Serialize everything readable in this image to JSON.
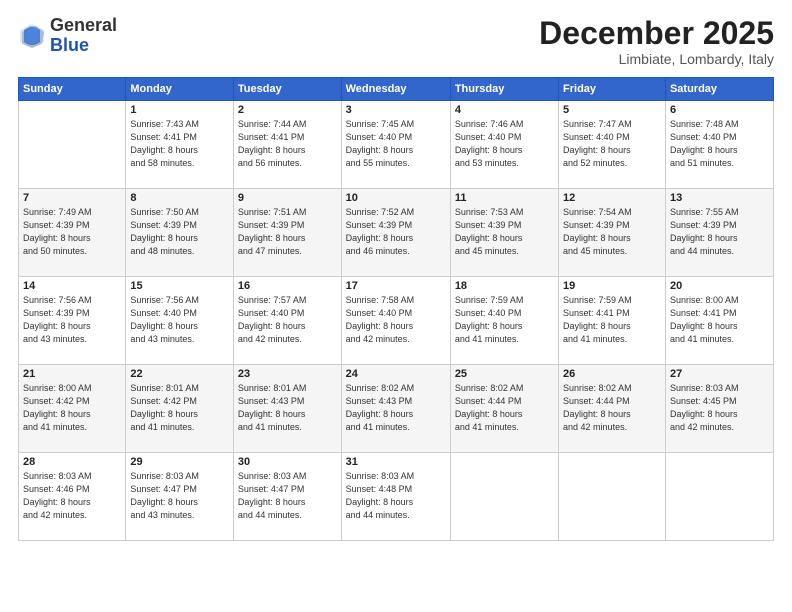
{
  "logo": {
    "general": "General",
    "blue": "Blue"
  },
  "header": {
    "month": "December 2025",
    "location": "Limbiate, Lombardy, Italy"
  },
  "days_of_week": [
    "Sunday",
    "Monday",
    "Tuesday",
    "Wednesday",
    "Thursday",
    "Friday",
    "Saturday"
  ],
  "weeks": [
    [
      {
        "day": "",
        "info": ""
      },
      {
        "day": "1",
        "info": "Sunrise: 7:43 AM\nSunset: 4:41 PM\nDaylight: 8 hours\nand 58 minutes."
      },
      {
        "day": "2",
        "info": "Sunrise: 7:44 AM\nSunset: 4:41 PM\nDaylight: 8 hours\nand 56 minutes."
      },
      {
        "day": "3",
        "info": "Sunrise: 7:45 AM\nSunset: 4:40 PM\nDaylight: 8 hours\nand 55 minutes."
      },
      {
        "day": "4",
        "info": "Sunrise: 7:46 AM\nSunset: 4:40 PM\nDaylight: 8 hours\nand 53 minutes."
      },
      {
        "day": "5",
        "info": "Sunrise: 7:47 AM\nSunset: 4:40 PM\nDaylight: 8 hours\nand 52 minutes."
      },
      {
        "day": "6",
        "info": "Sunrise: 7:48 AM\nSunset: 4:40 PM\nDaylight: 8 hours\nand 51 minutes."
      }
    ],
    [
      {
        "day": "7",
        "info": "Sunrise: 7:49 AM\nSunset: 4:39 PM\nDaylight: 8 hours\nand 50 minutes."
      },
      {
        "day": "8",
        "info": "Sunrise: 7:50 AM\nSunset: 4:39 PM\nDaylight: 8 hours\nand 48 minutes."
      },
      {
        "day": "9",
        "info": "Sunrise: 7:51 AM\nSunset: 4:39 PM\nDaylight: 8 hours\nand 47 minutes."
      },
      {
        "day": "10",
        "info": "Sunrise: 7:52 AM\nSunset: 4:39 PM\nDaylight: 8 hours\nand 46 minutes."
      },
      {
        "day": "11",
        "info": "Sunrise: 7:53 AM\nSunset: 4:39 PM\nDaylight: 8 hours\nand 45 minutes."
      },
      {
        "day": "12",
        "info": "Sunrise: 7:54 AM\nSunset: 4:39 PM\nDaylight: 8 hours\nand 45 minutes."
      },
      {
        "day": "13",
        "info": "Sunrise: 7:55 AM\nSunset: 4:39 PM\nDaylight: 8 hours\nand 44 minutes."
      }
    ],
    [
      {
        "day": "14",
        "info": "Sunrise: 7:56 AM\nSunset: 4:39 PM\nDaylight: 8 hours\nand 43 minutes."
      },
      {
        "day": "15",
        "info": "Sunrise: 7:56 AM\nSunset: 4:40 PM\nDaylight: 8 hours\nand 43 minutes."
      },
      {
        "day": "16",
        "info": "Sunrise: 7:57 AM\nSunset: 4:40 PM\nDaylight: 8 hours\nand 42 minutes."
      },
      {
        "day": "17",
        "info": "Sunrise: 7:58 AM\nSunset: 4:40 PM\nDaylight: 8 hours\nand 42 minutes."
      },
      {
        "day": "18",
        "info": "Sunrise: 7:59 AM\nSunset: 4:40 PM\nDaylight: 8 hours\nand 41 minutes."
      },
      {
        "day": "19",
        "info": "Sunrise: 7:59 AM\nSunset: 4:41 PM\nDaylight: 8 hours\nand 41 minutes."
      },
      {
        "day": "20",
        "info": "Sunrise: 8:00 AM\nSunset: 4:41 PM\nDaylight: 8 hours\nand 41 minutes."
      }
    ],
    [
      {
        "day": "21",
        "info": "Sunrise: 8:00 AM\nSunset: 4:42 PM\nDaylight: 8 hours\nand 41 minutes."
      },
      {
        "day": "22",
        "info": "Sunrise: 8:01 AM\nSunset: 4:42 PM\nDaylight: 8 hours\nand 41 minutes."
      },
      {
        "day": "23",
        "info": "Sunrise: 8:01 AM\nSunset: 4:43 PM\nDaylight: 8 hours\nand 41 minutes."
      },
      {
        "day": "24",
        "info": "Sunrise: 8:02 AM\nSunset: 4:43 PM\nDaylight: 8 hours\nand 41 minutes."
      },
      {
        "day": "25",
        "info": "Sunrise: 8:02 AM\nSunset: 4:44 PM\nDaylight: 8 hours\nand 41 minutes."
      },
      {
        "day": "26",
        "info": "Sunrise: 8:02 AM\nSunset: 4:44 PM\nDaylight: 8 hours\nand 42 minutes."
      },
      {
        "day": "27",
        "info": "Sunrise: 8:03 AM\nSunset: 4:45 PM\nDaylight: 8 hours\nand 42 minutes."
      }
    ],
    [
      {
        "day": "28",
        "info": "Sunrise: 8:03 AM\nSunset: 4:46 PM\nDaylight: 8 hours\nand 42 minutes."
      },
      {
        "day": "29",
        "info": "Sunrise: 8:03 AM\nSunset: 4:47 PM\nDaylight: 8 hours\nand 43 minutes."
      },
      {
        "day": "30",
        "info": "Sunrise: 8:03 AM\nSunset: 4:47 PM\nDaylight: 8 hours\nand 44 minutes."
      },
      {
        "day": "31",
        "info": "Sunrise: 8:03 AM\nSunset: 4:48 PM\nDaylight: 8 hours\nand 44 minutes."
      },
      {
        "day": "",
        "info": ""
      },
      {
        "day": "",
        "info": ""
      },
      {
        "day": "",
        "info": ""
      }
    ]
  ]
}
